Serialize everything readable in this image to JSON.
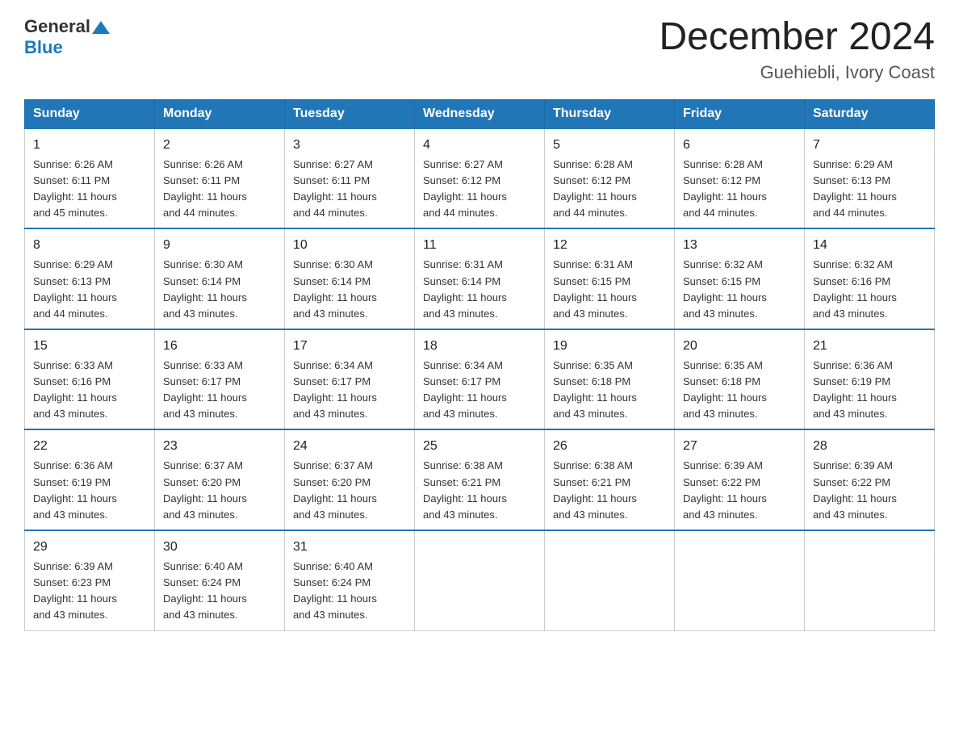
{
  "header": {
    "logo_general": "General",
    "logo_blue": "Blue",
    "title": "December 2024",
    "subtitle": "Guehiebli, Ivory Coast"
  },
  "days_of_week": [
    "Sunday",
    "Monday",
    "Tuesday",
    "Wednesday",
    "Thursday",
    "Friday",
    "Saturday"
  ],
  "weeks": [
    [
      {
        "day": "1",
        "sunrise": "6:26 AM",
        "sunset": "6:11 PM",
        "daylight": "11 hours and 45 minutes."
      },
      {
        "day": "2",
        "sunrise": "6:26 AM",
        "sunset": "6:11 PM",
        "daylight": "11 hours and 44 minutes."
      },
      {
        "day": "3",
        "sunrise": "6:27 AM",
        "sunset": "6:11 PM",
        "daylight": "11 hours and 44 minutes."
      },
      {
        "day": "4",
        "sunrise": "6:27 AM",
        "sunset": "6:12 PM",
        "daylight": "11 hours and 44 minutes."
      },
      {
        "day": "5",
        "sunrise": "6:28 AM",
        "sunset": "6:12 PM",
        "daylight": "11 hours and 44 minutes."
      },
      {
        "day": "6",
        "sunrise": "6:28 AM",
        "sunset": "6:12 PM",
        "daylight": "11 hours and 44 minutes."
      },
      {
        "day": "7",
        "sunrise": "6:29 AM",
        "sunset": "6:13 PM",
        "daylight": "11 hours and 44 minutes."
      }
    ],
    [
      {
        "day": "8",
        "sunrise": "6:29 AM",
        "sunset": "6:13 PM",
        "daylight": "11 hours and 44 minutes."
      },
      {
        "day": "9",
        "sunrise": "6:30 AM",
        "sunset": "6:14 PM",
        "daylight": "11 hours and 43 minutes."
      },
      {
        "day": "10",
        "sunrise": "6:30 AM",
        "sunset": "6:14 PM",
        "daylight": "11 hours and 43 minutes."
      },
      {
        "day": "11",
        "sunrise": "6:31 AM",
        "sunset": "6:14 PM",
        "daylight": "11 hours and 43 minutes."
      },
      {
        "day": "12",
        "sunrise": "6:31 AM",
        "sunset": "6:15 PM",
        "daylight": "11 hours and 43 minutes."
      },
      {
        "day": "13",
        "sunrise": "6:32 AM",
        "sunset": "6:15 PM",
        "daylight": "11 hours and 43 minutes."
      },
      {
        "day": "14",
        "sunrise": "6:32 AM",
        "sunset": "6:16 PM",
        "daylight": "11 hours and 43 minutes."
      }
    ],
    [
      {
        "day": "15",
        "sunrise": "6:33 AM",
        "sunset": "6:16 PM",
        "daylight": "11 hours and 43 minutes."
      },
      {
        "day": "16",
        "sunrise": "6:33 AM",
        "sunset": "6:17 PM",
        "daylight": "11 hours and 43 minutes."
      },
      {
        "day": "17",
        "sunrise": "6:34 AM",
        "sunset": "6:17 PM",
        "daylight": "11 hours and 43 minutes."
      },
      {
        "day": "18",
        "sunrise": "6:34 AM",
        "sunset": "6:17 PM",
        "daylight": "11 hours and 43 minutes."
      },
      {
        "day": "19",
        "sunrise": "6:35 AM",
        "sunset": "6:18 PM",
        "daylight": "11 hours and 43 minutes."
      },
      {
        "day": "20",
        "sunrise": "6:35 AM",
        "sunset": "6:18 PM",
        "daylight": "11 hours and 43 minutes."
      },
      {
        "day": "21",
        "sunrise": "6:36 AM",
        "sunset": "6:19 PM",
        "daylight": "11 hours and 43 minutes."
      }
    ],
    [
      {
        "day": "22",
        "sunrise": "6:36 AM",
        "sunset": "6:19 PM",
        "daylight": "11 hours and 43 minutes."
      },
      {
        "day": "23",
        "sunrise": "6:37 AM",
        "sunset": "6:20 PM",
        "daylight": "11 hours and 43 minutes."
      },
      {
        "day": "24",
        "sunrise": "6:37 AM",
        "sunset": "6:20 PM",
        "daylight": "11 hours and 43 minutes."
      },
      {
        "day": "25",
        "sunrise": "6:38 AM",
        "sunset": "6:21 PM",
        "daylight": "11 hours and 43 minutes."
      },
      {
        "day": "26",
        "sunrise": "6:38 AM",
        "sunset": "6:21 PM",
        "daylight": "11 hours and 43 minutes."
      },
      {
        "day": "27",
        "sunrise": "6:39 AM",
        "sunset": "6:22 PM",
        "daylight": "11 hours and 43 minutes."
      },
      {
        "day": "28",
        "sunrise": "6:39 AM",
        "sunset": "6:22 PM",
        "daylight": "11 hours and 43 minutes."
      }
    ],
    [
      {
        "day": "29",
        "sunrise": "6:39 AM",
        "sunset": "6:23 PM",
        "daylight": "11 hours and 43 minutes."
      },
      {
        "day": "30",
        "sunrise": "6:40 AM",
        "sunset": "6:24 PM",
        "daylight": "11 hours and 43 minutes."
      },
      {
        "day": "31",
        "sunrise": "6:40 AM",
        "sunset": "6:24 PM",
        "daylight": "11 hours and 43 minutes."
      },
      null,
      null,
      null,
      null
    ]
  ],
  "labels": {
    "sunrise": "Sunrise:",
    "sunset": "Sunset:",
    "daylight": "Daylight:"
  }
}
